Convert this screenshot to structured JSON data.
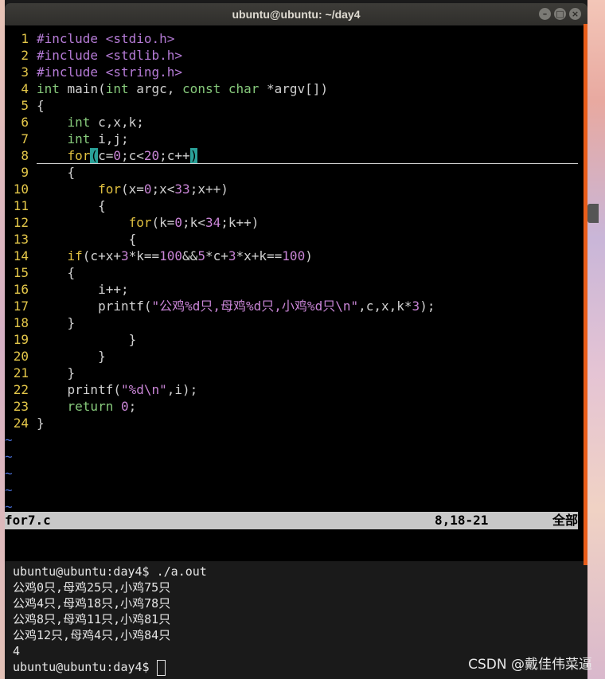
{
  "window": {
    "title": "ubuntu@ubuntu: ~/day4"
  },
  "editor": {
    "lines": [
      {
        "n": "1",
        "t": [
          [
            "inc",
            "#include "
          ],
          [
            "inc",
            "<stdio.h>"
          ]
        ]
      },
      {
        "n": "2",
        "t": [
          [
            "inc",
            "#include "
          ],
          [
            "inc",
            "<stdlib.h>"
          ]
        ]
      },
      {
        "n": "3",
        "t": [
          [
            "inc",
            "#include "
          ],
          [
            "inc",
            "<string.h>"
          ]
        ]
      },
      {
        "n": "4",
        "t": [
          [
            "kw",
            "int"
          ],
          [
            "code",
            " main("
          ],
          [
            "kw",
            "int"
          ],
          [
            "code",
            " argc, "
          ],
          [
            "kw",
            "const char"
          ],
          [
            "code",
            " *argv[])"
          ]
        ]
      },
      {
        "n": "5",
        "t": [
          [
            "code",
            "{"
          ]
        ]
      },
      {
        "n": "6",
        "t": [
          [
            "code",
            "    "
          ],
          [
            "kw",
            "int"
          ],
          [
            "code",
            " c,x,k;"
          ]
        ]
      },
      {
        "n": "7",
        "t": [
          [
            "code",
            "    "
          ],
          [
            "kw",
            "int"
          ],
          [
            "code",
            " i,j;"
          ]
        ]
      },
      {
        "n": "8",
        "cursor": true,
        "t": [
          [
            "code",
            "    "
          ],
          [
            "ctl",
            "for"
          ],
          [
            "hl",
            "("
          ],
          [
            "code",
            "c="
          ],
          [
            "num",
            "0"
          ],
          [
            "code",
            ";c<"
          ],
          [
            "num",
            "20"
          ],
          [
            "code",
            ";c++"
          ],
          [
            "hl",
            ")"
          ]
        ]
      },
      {
        "n": "9",
        "t": [
          [
            "code",
            "    {"
          ]
        ]
      },
      {
        "n": "10",
        "t": [
          [
            "code",
            "        "
          ],
          [
            "ctl",
            "for"
          ],
          [
            "code",
            "(x="
          ],
          [
            "num",
            "0"
          ],
          [
            "code",
            ";x<"
          ],
          [
            "num",
            "33"
          ],
          [
            "code",
            ";x++)"
          ]
        ]
      },
      {
        "n": "11",
        "t": [
          [
            "code",
            "        {"
          ]
        ]
      },
      {
        "n": "12",
        "t": [
          [
            "code",
            "            "
          ],
          [
            "ctl",
            "for"
          ],
          [
            "code",
            "(k="
          ],
          [
            "num",
            "0"
          ],
          [
            "code",
            ";k<"
          ],
          [
            "num",
            "34"
          ],
          [
            "code",
            ";k++)"
          ]
        ]
      },
      {
        "n": "13",
        "t": [
          [
            "code",
            "            {"
          ]
        ]
      },
      {
        "n": "14",
        "t": [
          [
            "code",
            "    "
          ],
          [
            "ctl",
            "if"
          ],
          [
            "code",
            "(c+x+"
          ],
          [
            "num",
            "3"
          ],
          [
            "code",
            "*k=="
          ],
          [
            "num",
            "100"
          ],
          [
            "code",
            "&&"
          ],
          [
            "num",
            "5"
          ],
          [
            "code",
            "*c+"
          ],
          [
            "num",
            "3"
          ],
          [
            "code",
            "*x+k=="
          ],
          [
            "num",
            "100"
          ],
          [
            "code",
            ")"
          ]
        ]
      },
      {
        "n": "15",
        "t": [
          [
            "code",
            "    {"
          ]
        ]
      },
      {
        "n": "16",
        "t": [
          [
            "code",
            "        i++;"
          ]
        ]
      },
      {
        "n": "17",
        "t": [
          [
            "code",
            "        printf("
          ],
          [
            "str",
            "\"公鸡%d只,母鸡%d只,小鸡%d只\\n\""
          ],
          [
            "code",
            ",c,x,k*"
          ],
          [
            "num",
            "3"
          ],
          [
            "code",
            ");"
          ]
        ]
      },
      {
        "n": "18",
        "t": [
          [
            "code",
            "    }"
          ]
        ]
      },
      {
        "n": "19",
        "t": [
          [
            "code",
            "            }"
          ]
        ]
      },
      {
        "n": "20",
        "t": [
          [
            "code",
            "        }"
          ]
        ]
      },
      {
        "n": "21",
        "t": [
          [
            "code",
            "    }"
          ]
        ]
      },
      {
        "n": "22",
        "t": [
          [
            "code",
            "    printf("
          ],
          [
            "str",
            "\"%d\\n\""
          ],
          [
            "code",
            ",i);"
          ]
        ]
      },
      {
        "n": "23",
        "t": [
          [
            "code",
            "    "
          ],
          [
            "kw",
            "return"
          ],
          [
            "code",
            " "
          ],
          [
            "num",
            "0"
          ],
          [
            "code",
            ";"
          ]
        ]
      },
      {
        "n": "24",
        "t": [
          [
            "code",
            "}"
          ]
        ]
      }
    ],
    "tilde_count": 5,
    "tilde": "~"
  },
  "statusline": {
    "filename": "for7.c",
    "position": "8,18-21",
    "scroll": "全部"
  },
  "terminal": {
    "lines": [
      "ubuntu@ubuntu:day4$ ./a.out",
      "公鸡0只,母鸡25只,小鸡75只",
      "公鸡4只,母鸡18只,小鸡78只",
      "公鸡8只,母鸡11只,小鸡81只",
      "公鸡12只,母鸡4只,小鸡84只",
      "4"
    ],
    "prompt": "ubuntu@ubuntu:day4$ "
  },
  "watermark": "CSDN @戴佳伟菜逼",
  "window_buttons": {
    "minimize": "–",
    "maximize": "□",
    "close": "×"
  }
}
